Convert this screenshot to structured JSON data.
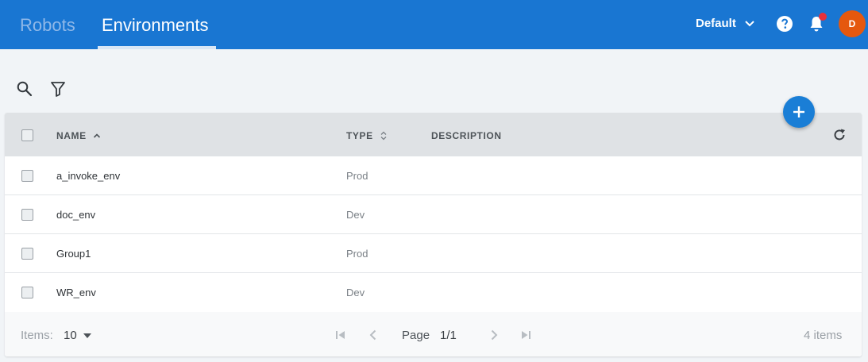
{
  "nav": {
    "tabs": [
      {
        "label": "Robots",
        "active": false
      },
      {
        "label": "Environments",
        "active": true
      }
    ],
    "tenant": "Default",
    "avatar_initial": "D",
    "icons": [
      "help-icon",
      "bell-icon",
      "chevron-down-icon"
    ],
    "colors": {
      "bar": "#1976d2",
      "avatar": "#e5580e",
      "notification_dot": "#e8303a"
    }
  },
  "toolbar": {
    "icons": [
      "search-icon",
      "filter-icon"
    ]
  },
  "table": {
    "columns": [
      {
        "label": "NAME",
        "sort": "ascending"
      },
      {
        "label": "TYPE",
        "sort": "sortable"
      },
      {
        "label": "DESCRIPTION"
      }
    ],
    "rows": [
      {
        "name": "a_invoke_env",
        "type": "Prod",
        "description": ""
      },
      {
        "name": "doc_env",
        "type": "Dev",
        "description": ""
      },
      {
        "name": "Group1",
        "type": "Prod",
        "description": ""
      },
      {
        "name": "WR_env",
        "type": "Dev",
        "description": ""
      }
    ]
  },
  "footer": {
    "items_label": "Items:",
    "page_size": "10",
    "page_label": "Page",
    "page_value": "1/1",
    "total": "4 items"
  },
  "fab": {
    "icon": "plus-icon",
    "color": "#1a7ed6"
  }
}
